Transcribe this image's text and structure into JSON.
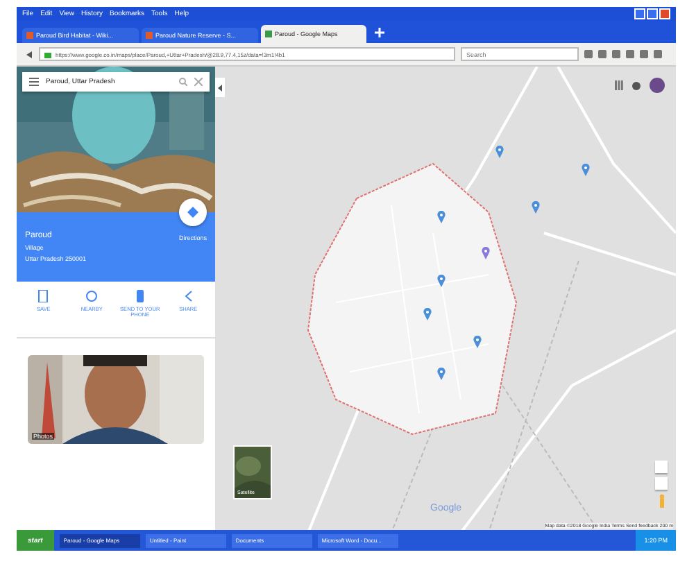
{
  "menu": [
    "File",
    "Edit",
    "View",
    "History",
    "Bookmarks",
    "Tools",
    "Help"
  ],
  "tabs": [
    {
      "label": "Paroud Bird Habitat - Wiki...",
      "selected": false
    },
    {
      "label": "Paroud Nature Reserve - S...",
      "selected": false
    },
    {
      "label": "Paroud - Google Maps",
      "selected": true
    }
  ],
  "address": {
    "value": "https://www.google.co.in/maps/place/Paroud,+Uttar+Pradesh/@28.9,77.4,15z/data=!3m1!4b1"
  },
  "search": {
    "placeholder": "Search"
  },
  "place_search": {
    "value": "Paroud, Uttar Pradesh"
  },
  "place": {
    "name": "Paroud",
    "type": "Village",
    "address": "Uttar Pradesh 250001",
    "directions": "Directions"
  },
  "actions": [
    {
      "kind": "save",
      "label": "SAVE"
    },
    {
      "kind": "nearby",
      "label": "NEARBY"
    },
    {
      "kind": "phone",
      "label": "SEND TO YOUR PHONE"
    },
    {
      "kind": "share",
      "label": "SHARE"
    }
  ],
  "photos": {
    "label": "Photos"
  },
  "map": {
    "satellite": "Satellite",
    "logo": "Google",
    "footer": "Map data ©2018 Google   India   Terms   Send feedback   200 m",
    "pins": [
      {
        "color": "#4a8fd8"
      },
      {
        "color": "#4a8fd8"
      },
      {
        "color": "#4a8fd8"
      },
      {
        "color": "#8a7ad8"
      },
      {
        "color": "#4a8fd8"
      },
      {
        "color": "#4a8fd8"
      },
      {
        "color": "#4a8fd8"
      },
      {
        "color": "#4a8fd8"
      },
      {
        "color": "#4a8fd8"
      }
    ]
  },
  "taskbar": {
    "start": "start",
    "items": [
      "Paroud - Google Maps",
      "Untitled - Paint",
      "Documents",
      "Microsoft Word - Docu..."
    ],
    "clock": "1:20 PM"
  }
}
